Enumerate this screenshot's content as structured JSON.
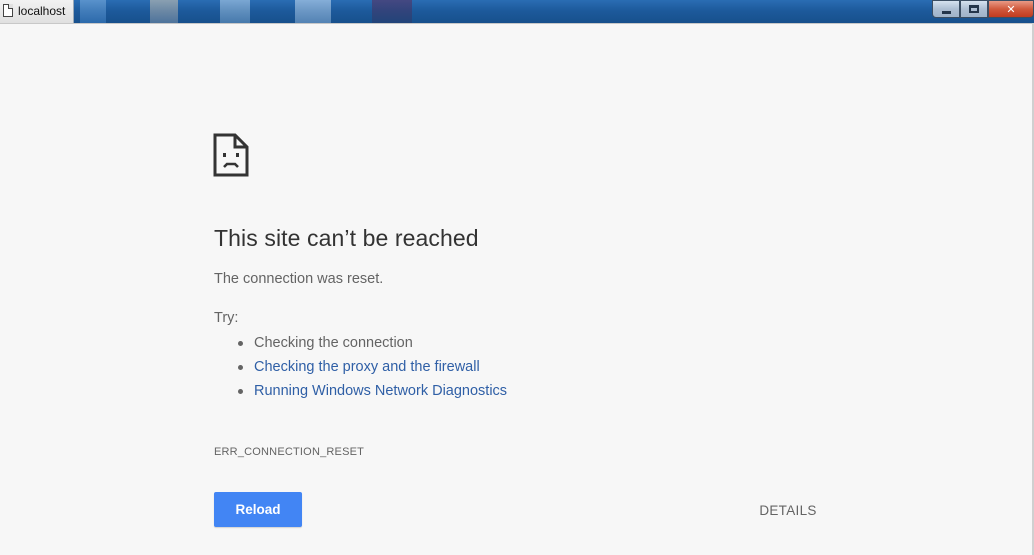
{
  "window": {
    "title": "localhost",
    "controls": {
      "minimize": "minimize",
      "maximize": "maximize",
      "close": "close"
    }
  },
  "error": {
    "heading": "This site can’t be reached",
    "message": "The connection was reset.",
    "try_label": "Try:",
    "suggestions": [
      {
        "text": "Checking the connection",
        "link": false
      },
      {
        "text": "Checking the proxy and the firewall",
        "link": true
      },
      {
        "text": "Running Windows Network Diagnostics",
        "link": true
      }
    ],
    "code": "ERR_CONNECTION_RESET"
  },
  "buttons": {
    "reload": "Reload",
    "details": "DETAILS"
  },
  "colors": {
    "accent": "#4285f4",
    "link": "#2f5fa6",
    "body_text": "#646464",
    "heading_text": "#333333",
    "background": "#f7f7f7"
  },
  "icons": {
    "window_controls": "✕",
    "error": "sad-document-icon"
  }
}
